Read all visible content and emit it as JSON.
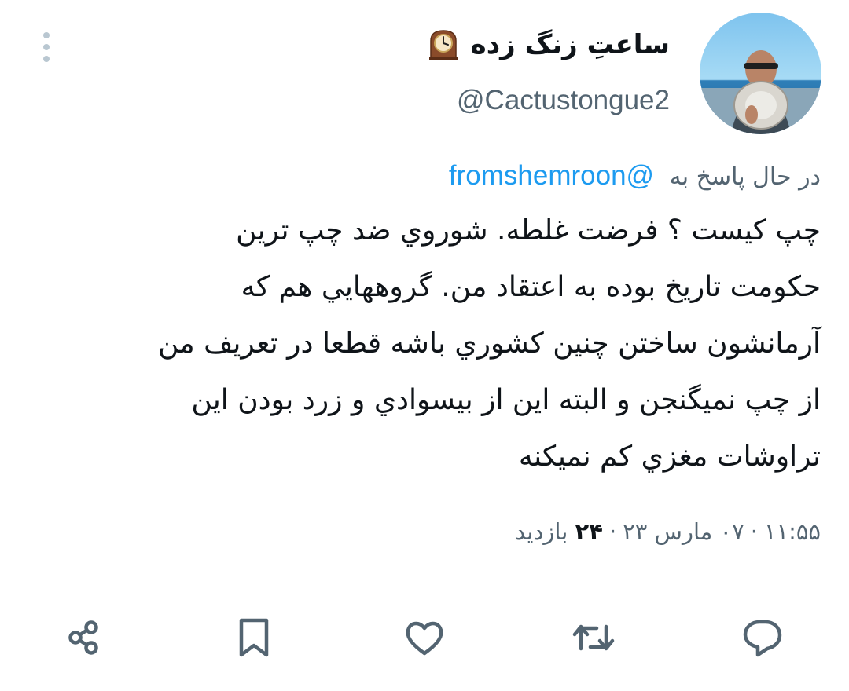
{
  "author": {
    "display_name": "ساعتِ زنگ زده",
    "name_emoji_icon": "mantelpiece-clock-icon",
    "handle": "@Cactustongue2",
    "avatar_icon": "profile-photo"
  },
  "reply": {
    "prefix": "در حال پاسخ به",
    "mention": "@fromshemroon"
  },
  "tweet": {
    "lines": [
      "چپ كيست ؟ فرضت غلطه. شوروي ضد چپ ترين",
      "حكومت تاريخ بوده به اعتقاد من. گروههايي هم كه",
      "آرمانشون ساختن چنين كشوري باشه قطعا در تعريف من",
      "از چپ نميگنجن و البته اين از بيسوادي و زرد بودن اين",
      "تراوشات مغزي كم نميكنه"
    ]
  },
  "meta": {
    "time": "۱۱:۵۵",
    "date": "۰۷ مارس ۲۳",
    "views_count": "۲۴",
    "views_label": "بازدید",
    "separator": "·"
  },
  "actions": [
    {
      "name": "reply",
      "icon": "reply-icon"
    },
    {
      "name": "retweet",
      "icon": "retweet-icon"
    },
    {
      "name": "like",
      "icon": "like-icon"
    },
    {
      "name": "bookmark",
      "icon": "bookmark-icon"
    },
    {
      "name": "share",
      "icon": "share-icon"
    }
  ],
  "colors": {
    "link": "#1d9bf0",
    "secondary_text": "#536471",
    "primary_text": "#0f1419",
    "divider": "#cfd9de"
  }
}
